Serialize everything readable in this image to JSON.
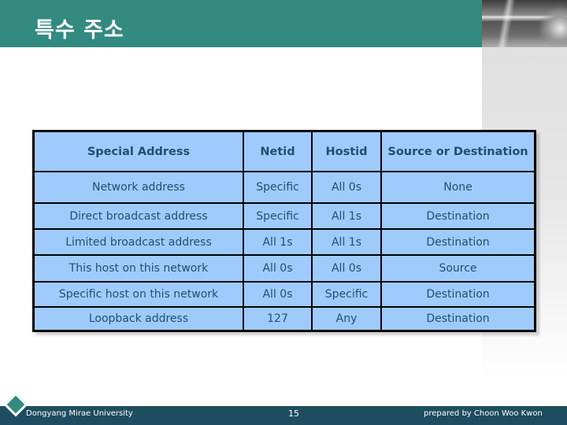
{
  "slide": {
    "title": "특수 주소",
    "colors": {
      "header": "#338a80",
      "footer": "#1d4d5f",
      "table_fill": "#9fcbfc",
      "table_text": "#1e5070"
    }
  },
  "table": {
    "headers": [
      "Special Address",
      "Netid",
      "Hostid",
      "Source or Destination"
    ],
    "rows": [
      [
        "Network address",
        "Specific",
        "All  0s",
        "None"
      ],
      [
        "Direct broadcast address",
        "Specific",
        "All   1s",
        "Destination"
      ],
      [
        "Limited broadcast address",
        "All   1s",
        "All   1s",
        "Destination"
      ],
      [
        "This host on this network",
        "All  0s",
        "All  0s",
        "Source"
      ],
      [
        "Specific host on this network",
        "All  0s",
        "Specific",
        "Destination"
      ],
      [
        "Loopback address",
        "127",
        "Any",
        "Destination"
      ]
    ]
  },
  "footer": {
    "school": "Dongyang Mirae University",
    "page_number": "15",
    "author": "prepared by Choon Woo Kwon"
  }
}
